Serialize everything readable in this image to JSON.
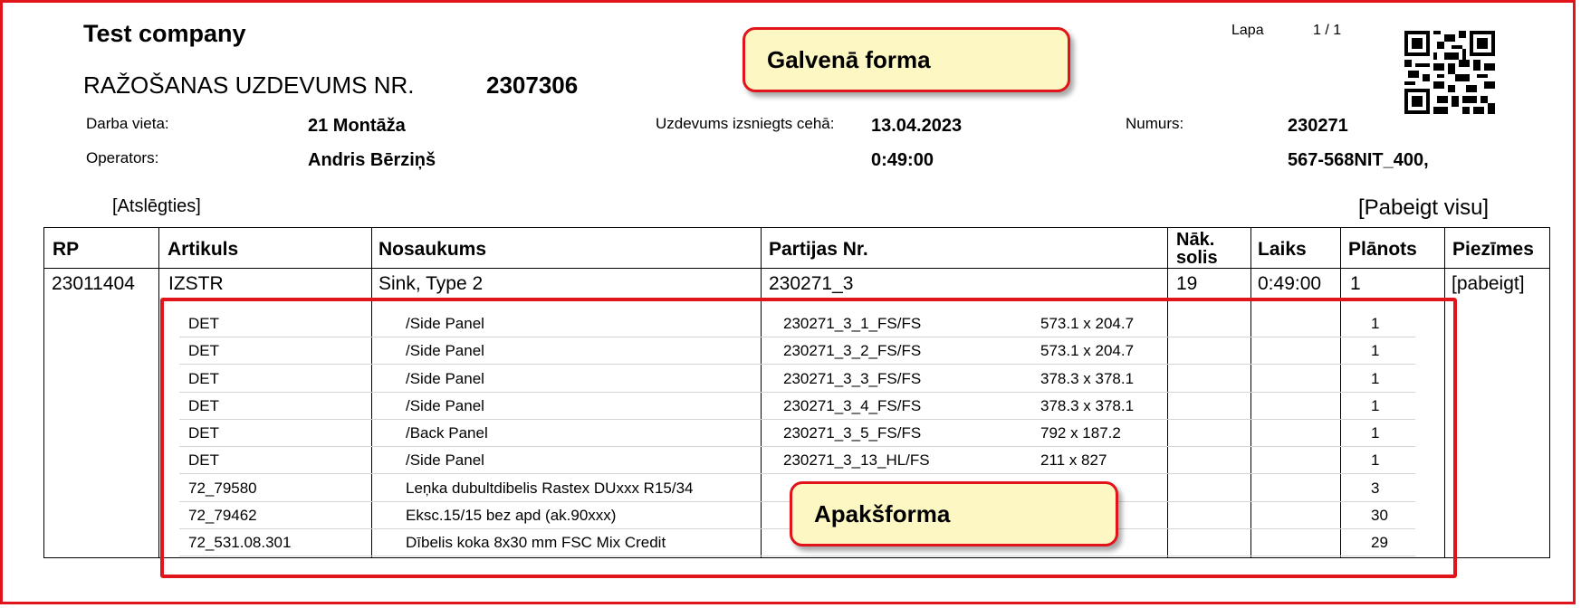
{
  "header": {
    "company": "Test company",
    "doc_title": "RAŽOŠANAS UZDEVUMS NR.",
    "doc_number": "2307306",
    "page_label": "Lapa",
    "page_value": "1 / 1"
  },
  "info": {
    "workplace_label": "Darba vieta:",
    "workplace_value": "21 Montāža",
    "operator_label": "Operators:",
    "operator_value": "Andris Bērziņš",
    "issued_label": "Uzdevums izsniegts cehā:",
    "issued_date": "13.04.2023",
    "issued_time": "0:49:00",
    "number_label": "Numurs:",
    "number_value": "230271",
    "number_value2": "567-568NIT_400,"
  },
  "links": {
    "logout": "[Atslēgties]",
    "finish_all": "[Pabeigt visu]"
  },
  "callouts": {
    "main_form": "Galvenā forma",
    "sub_form": "Apakšforma"
  },
  "colors": {
    "annotation_red": "#e0141a",
    "callout_fill": "#fdf7c3"
  },
  "table": {
    "headers": {
      "rp": "RP",
      "artikuls": "Artikuls",
      "nosaukums": "Nosaukums",
      "partijas": "Partijas Nr.",
      "nak_solis_1": "Nāk.",
      "nak_solis_2": "solis",
      "laiks": "Laiks",
      "planots": "Plānots",
      "piezimes": "Piezīmes"
    },
    "row": {
      "rp": "23011404",
      "artikuls": "IZSTR",
      "nosaukums": "Sink, Type 2",
      "partijas": "230271_3",
      "nak_solis": "19",
      "laiks": "0:49:00",
      "planots": "1",
      "piezimes": "[pabeigt]"
    },
    "sub_rows": [
      {
        "code": "DET",
        "name": "/Side Panel",
        "batch": "230271_3_1_FS/FS",
        "size": "573.1 x 204.7",
        "qty": "1"
      },
      {
        "code": "DET",
        "name": "/Side Panel",
        "batch": "230271_3_2_FS/FS",
        "size": "573.1 x 204.7",
        "qty": "1"
      },
      {
        "code": "DET",
        "name": "/Side Panel",
        "batch": "230271_3_3_FS/FS",
        "size": "378.3 x 378.1",
        "qty": "1"
      },
      {
        "code": "DET",
        "name": "/Side Panel",
        "batch": "230271_3_4_FS/FS",
        "size": "378.3 x 378.1",
        "qty": "1"
      },
      {
        "code": "DET",
        "name": "/Back Panel",
        "batch": "230271_3_5_FS/FS",
        "size": "792 x 187.2",
        "qty": "1"
      },
      {
        "code": "DET",
        "name": "/Side Panel",
        "batch": "230271_3_13_HL/FS",
        "size": "211 x 827",
        "qty": "1"
      },
      {
        "code": "72_79580",
        "name": "Leņka dubultdibelis Rastex DUxxx R15/34",
        "batch": "",
        "size": "",
        "qty": "3"
      },
      {
        "code": "72_79462",
        "name": "Eksc.15/15 bez apd (ak.90xxx)",
        "batch": "",
        "size": "",
        "qty": "30"
      },
      {
        "code": "72_531.08.301",
        "name": "Dībelis koka 8x30 mm FSC Mix Credit",
        "batch": "",
        "size": "",
        "qty": "29"
      }
    ]
  }
}
